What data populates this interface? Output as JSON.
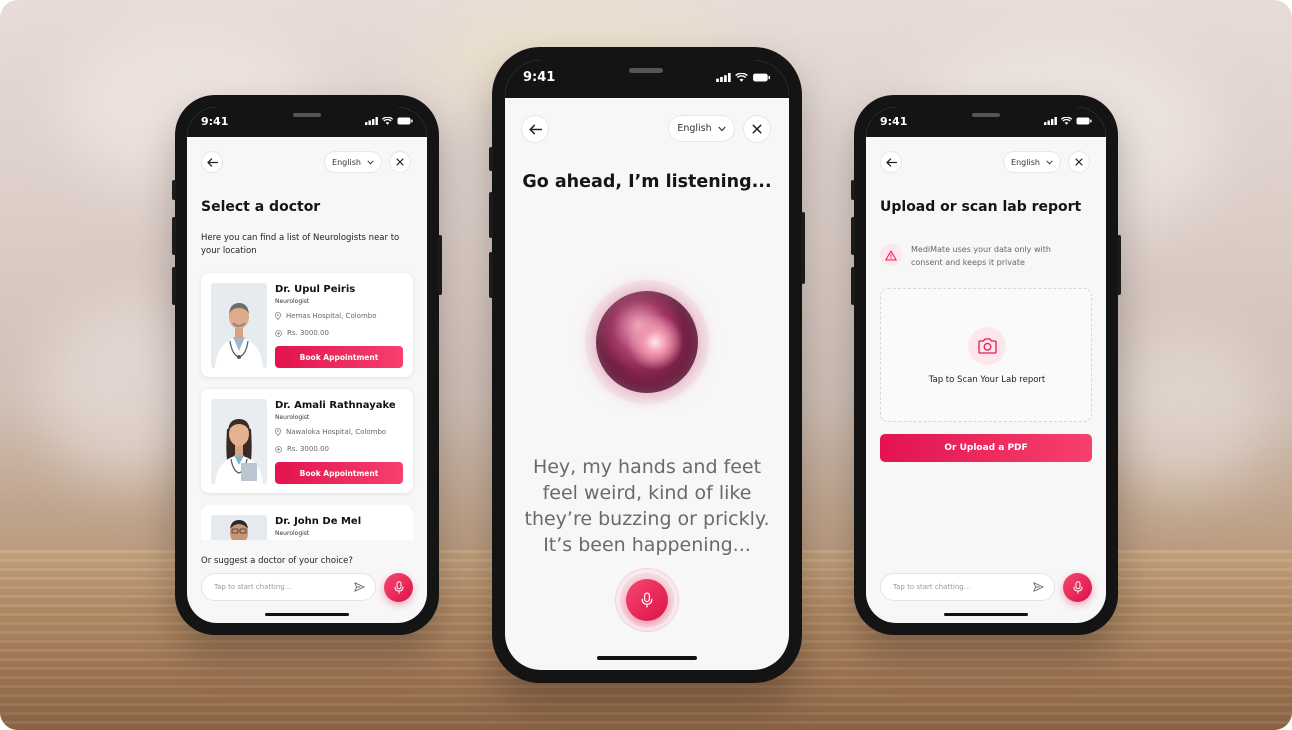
{
  "status": {
    "time": "9:41"
  },
  "left_screen": {
    "language": "English",
    "title": "Select a doctor",
    "subtitle": "Here you can find a list of Neurologists near to your location",
    "doctors": [
      {
        "name": "Dr. Upul Peiris",
        "specialty": "Neurologist",
        "hospital": "Hemas Hospital, Colombo",
        "fee": "Rs. 3000.00",
        "button": "Book Appointment"
      },
      {
        "name": "Dr. Amali Rathnayake",
        "specialty": "Neurologist",
        "hospital": "Nawaloka Hospital, Colombo",
        "fee": "Rs. 3000.00",
        "button": "Book Appointment"
      },
      {
        "name": "Dr. John De Mel",
        "specialty": "Neurologist"
      }
    ],
    "suggest_text": "Or suggest a doctor of your choice?",
    "chat_placeholder": "Tap to start chatting..."
  },
  "center_screen": {
    "language": "English",
    "heading": "Go ahead, I’m listening...",
    "transcript_lines": [
      "Hey, my hands and feet",
      "feel weird, kind of like",
      "they’re buzzing or prickly.",
      "It’s been happening..."
    ]
  },
  "right_screen": {
    "language": "English",
    "title": "Upload or scan lab report",
    "privacy_line1": "MediMate uses your data only with",
    "privacy_line2": "consent and keeps it private",
    "scan_label": "Tap to Scan Your Lab report",
    "upload_button": "Or Upload a PDF",
    "chat_placeholder": "Tap to start chatting..."
  },
  "colors": {
    "accent": "#e8184f",
    "accent_light": "#fde7ec"
  },
  "icons": [
    "back-arrow-icon",
    "chevron-down-icon",
    "close-icon",
    "location-pin-icon",
    "coin-icon",
    "send-icon",
    "microphone-icon",
    "camera-icon",
    "warning-icon",
    "signal-icon",
    "wifi-icon",
    "battery-icon"
  ]
}
